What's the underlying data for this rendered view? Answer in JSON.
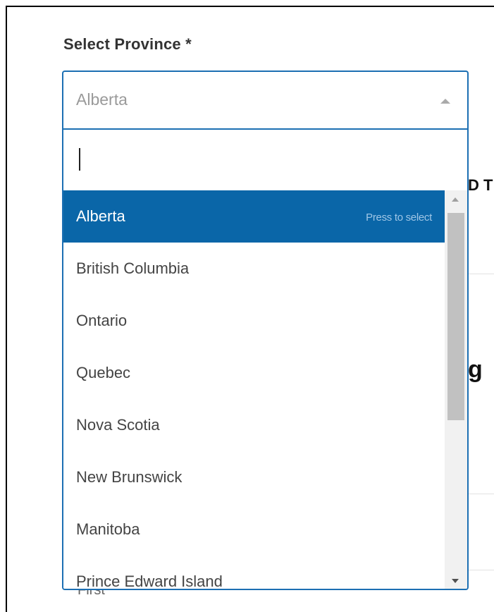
{
  "colors": {
    "accent": "#1c6fb3",
    "highlight": "#0a66a8"
  },
  "field": {
    "label": "Select Province *",
    "selected_value": "Alberta"
  },
  "search": {
    "value": "",
    "placeholder": ""
  },
  "options": [
    {
      "label": "Alberta",
      "hint": "Press to select"
    },
    {
      "label": "British Columbia"
    },
    {
      "label": "Ontario"
    },
    {
      "label": "Quebec"
    },
    {
      "label": "Nova Scotia"
    },
    {
      "label": "New Brunswick"
    },
    {
      "label": "Manitoba"
    },
    {
      "label": "Prince Edward Island"
    }
  ],
  "background": {
    "partial_text_1": "D T",
    "partial_text_2": "g",
    "partial_text_3": "First"
  },
  "icons": {
    "select_arrow": "caret-up-icon",
    "scroll_up": "scroll-up-arrow-icon",
    "scroll_down": "scroll-down-arrow-icon"
  }
}
